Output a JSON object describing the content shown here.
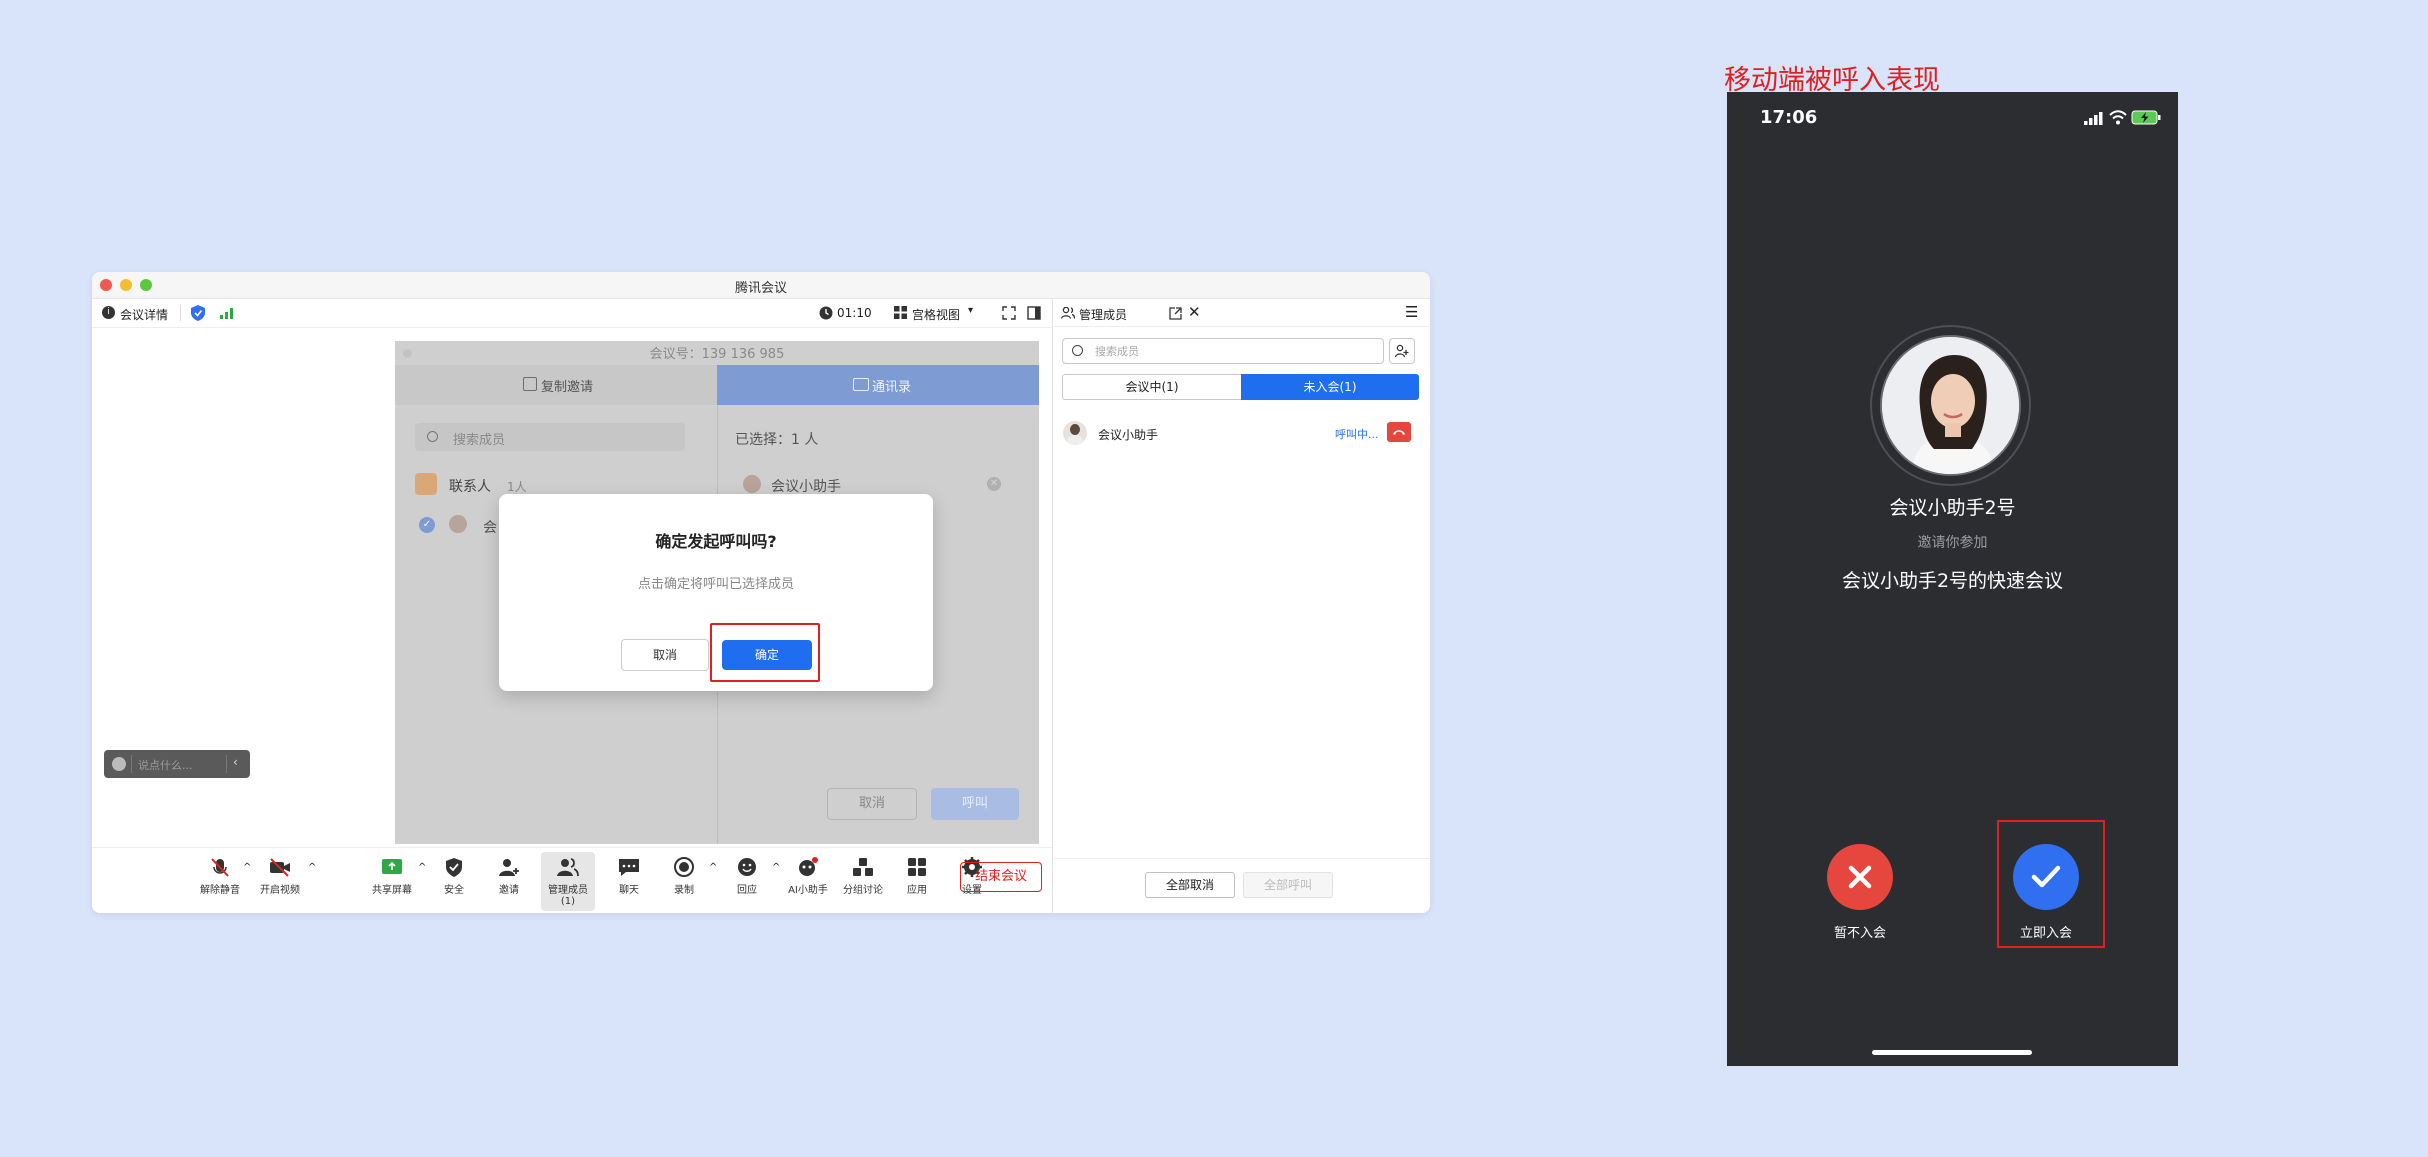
{
  "window": {
    "title": "腾讯会议",
    "info_label": "会议详情",
    "timer": "01:10",
    "view_label": "宫格视图",
    "chat_placeholder": "说点什么..."
  },
  "invite": {
    "meeting_id": "会议号：139 136 985",
    "copy_tab": "复制邀请",
    "contacts_tab": "通讯录",
    "search_placeholder": "搜索成员",
    "contacts_label": "联系人",
    "contacts_count": "1人",
    "member_partial": "会",
    "selected_label": "已选择：1 人",
    "selected_member": "会议小助手",
    "cancel": "取消",
    "call": "呼叫"
  },
  "modal": {
    "title": "确定发起呼叫吗?",
    "message": "点击确定将呼叫已选择成员",
    "cancel": "取消",
    "confirm": "确定",
    "highlight_color": "#e0201f",
    "confirm_color": "#1f6ef0"
  },
  "toolbar": {
    "items": [
      {
        "label": "解除静音",
        "icon": "mic-muted-icon"
      },
      {
        "label": "开启视频",
        "icon": "camera-off-icon"
      },
      {
        "label": "共享屏幕",
        "icon": "share-screen-icon"
      },
      {
        "label": "安全",
        "icon": "shield-icon"
      },
      {
        "label": "邀请",
        "icon": "invite-icon"
      },
      {
        "label": "管理成员(1)",
        "icon": "members-icon"
      },
      {
        "label": "聊天",
        "icon": "chat-icon"
      },
      {
        "label": "录制",
        "icon": "record-icon"
      },
      {
        "label": "回应",
        "icon": "emoji-icon"
      },
      {
        "label": "AI小助手",
        "icon": "ai-assistant-icon"
      },
      {
        "label": "分组讨论",
        "icon": "breakout-icon"
      },
      {
        "label": "应用",
        "icon": "apps-icon"
      },
      {
        "label": "设置",
        "icon": "gear-icon"
      }
    ],
    "end_meeting": "结束会议"
  },
  "members_panel": {
    "title": "管理成员",
    "search_placeholder": "搜索成员",
    "tab_in_meeting": "会议中(1)",
    "tab_not_joined": "未入会(1)",
    "member_name": "会议小助手",
    "member_status": "呼叫中...",
    "cancel_all": "全部取消",
    "call_all": "全部呼叫"
  },
  "mobile": {
    "caption": "移动端被呼入表现",
    "time": "17:06",
    "caller_name": "会议小助手2号",
    "invite_text": "邀请你参加",
    "meeting_name": "会议小助手2号的快速会议",
    "decline_label": "暂不入会",
    "accept_label": "立即入会",
    "decline_color": "#e5463d",
    "accept_color": "#2f6ff0"
  }
}
